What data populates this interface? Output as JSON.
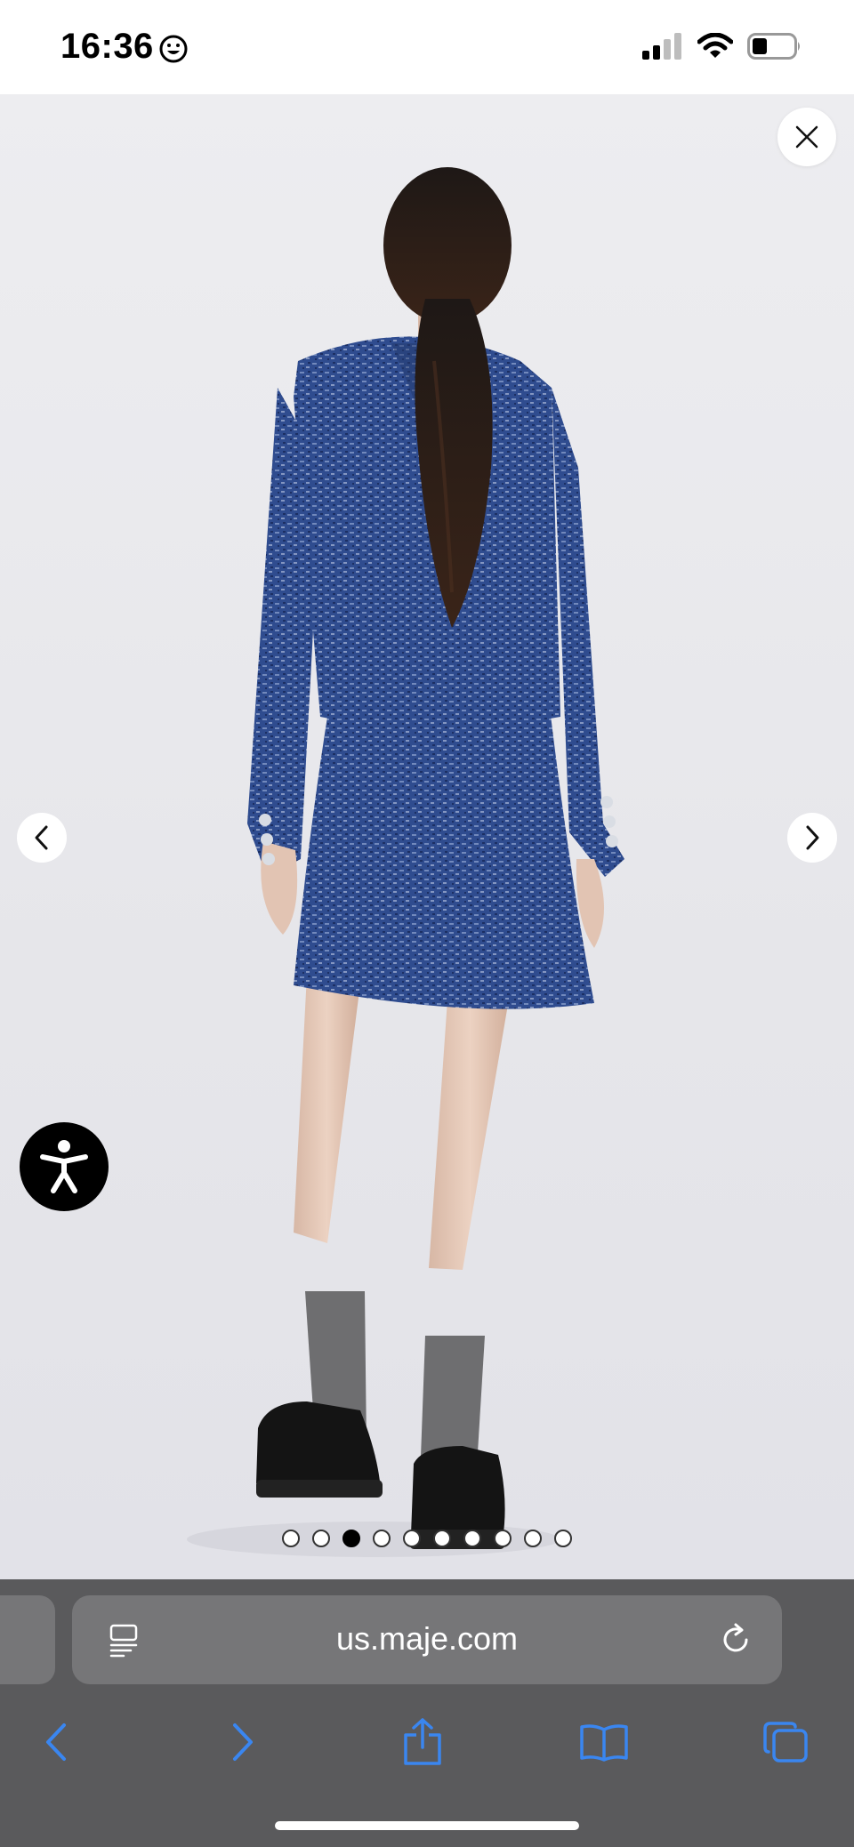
{
  "status_bar": {
    "time": "16:36",
    "emoji_icon": "smiley-face-icon",
    "signal_icon": "cellular-signal-icon",
    "wifi_icon": "wifi-icon",
    "battery_icon": "battery-icon"
  },
  "gallery": {
    "image_subject": "product photo",
    "close_icon": "close-icon",
    "prev_icon": "chevron-left-icon",
    "next_icon": "chevron-right-icon",
    "accessibility_icon": "accessibility-icon",
    "page_dots": {
      "count": 10,
      "active_index": 2
    }
  },
  "browser": {
    "url": "us.maje.com",
    "reader_icon": "reader-view-icon",
    "reload_icon": "reload-icon",
    "toolbar": [
      "back-icon",
      "forward-icon",
      "share-icon",
      "bookmarks-icon",
      "tabs-icon"
    ]
  },
  "colors": {
    "tweed_blue": "#2f4c8f",
    "chrome_gray": "#5a5a5c",
    "field_gray": "#767678",
    "accent_blue": "#3a86f0"
  }
}
